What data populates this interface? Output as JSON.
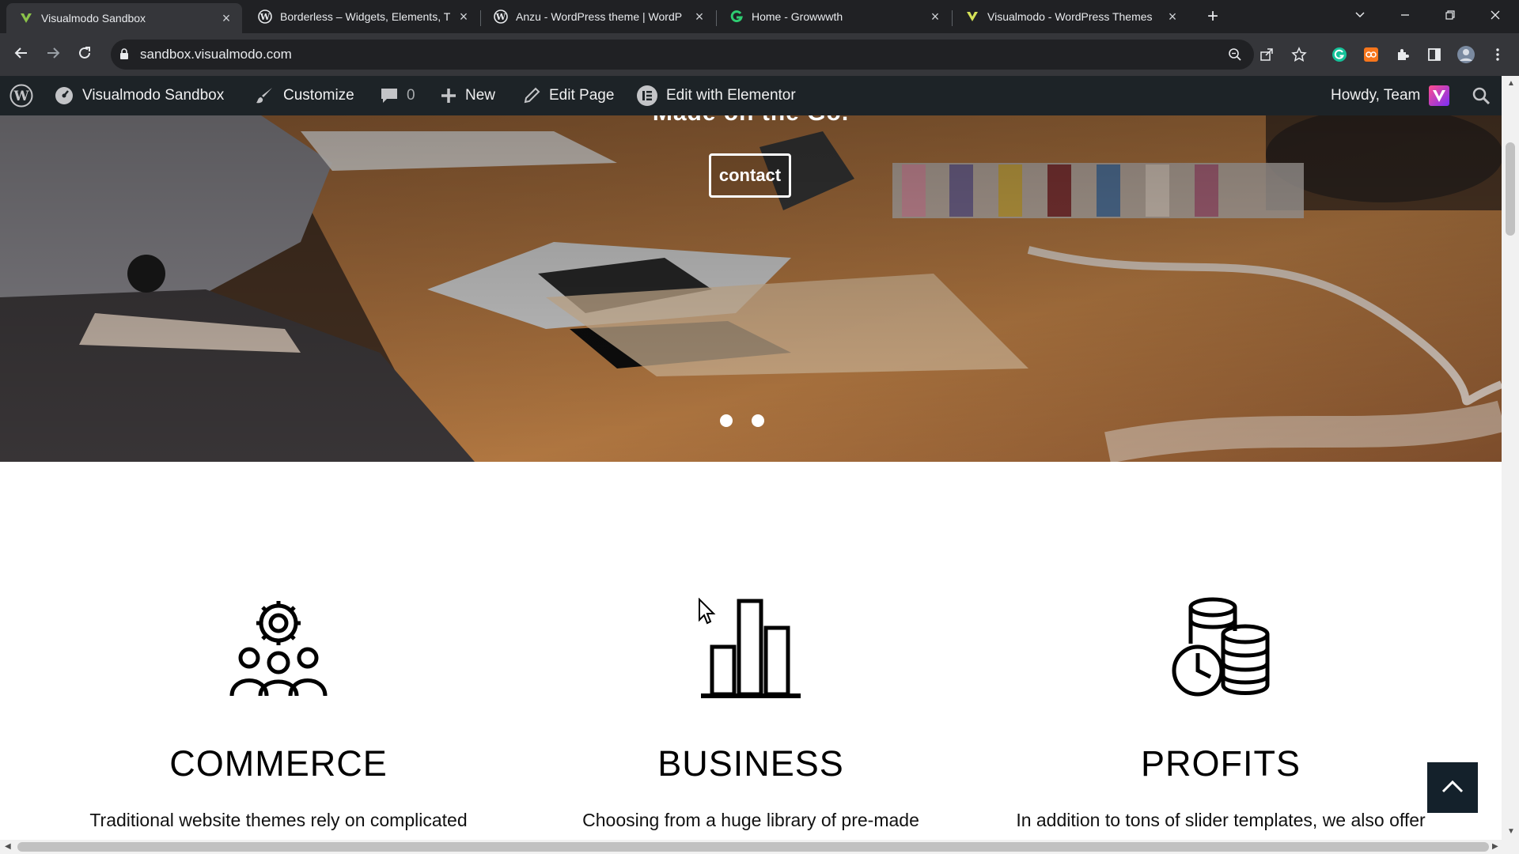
{
  "browser": {
    "tabs": [
      {
        "title": "Visualmodo Sandbox",
        "active": true,
        "favicon": "visualmodo-v-icon"
      },
      {
        "title": "Borderless – Widgets, Elements, T",
        "active": false,
        "favicon": "wordpress-icon"
      },
      {
        "title": "Anzu - WordPress theme | WordP",
        "active": false,
        "favicon": "wordpress-icon"
      },
      {
        "title": "Home - Growwwth",
        "active": false,
        "favicon": "growwwth-g-icon"
      },
      {
        "title": "Visualmodo - WordPress Themes",
        "active": false,
        "favicon": "visualmodo-v-icon"
      }
    ],
    "address": "sandbox.visualmodo.com"
  },
  "admin_bar": {
    "site_name": "Visualmodo Sandbox",
    "customize": "Customize",
    "comments_count": "0",
    "new": "New",
    "edit_page": "Edit Page",
    "edit_elementor": "Edit with Elementor",
    "howdy": "Howdy, Team"
  },
  "hero": {
    "headline": "Made on the Go.",
    "button": "contact",
    "slides": 2
  },
  "features": [
    {
      "title": "COMMERCE",
      "text": "Traditional website themes rely on complicated",
      "icon": "team-gear-icon"
    },
    {
      "title": "BUSINESS",
      "text": "Choosing from a huge library of pre-made",
      "icon": "bar-chart-icon"
    },
    {
      "title": "PROFITS",
      "text": "In addition to tons of slider templates, we also offer",
      "icon": "coins-clock-icon"
    }
  ],
  "colors": {
    "admin_bar": "#1d2327",
    "browser_frame": "#202124",
    "toolbar": "#35363a",
    "back_to_top": "#14212b"
  }
}
